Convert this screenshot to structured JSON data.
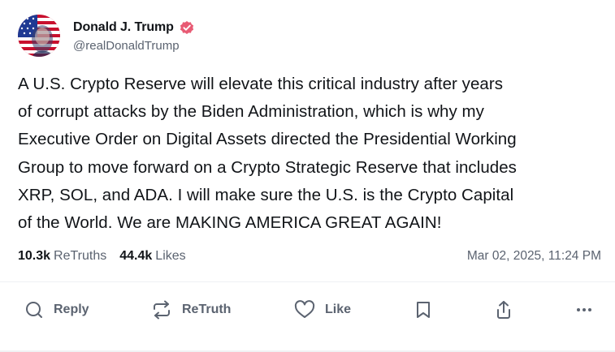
{
  "author": {
    "display_name": "Donald J. Trump",
    "handle": "@realDonaldTrump",
    "verified": true,
    "avatar_icon": "avatar-flag-portrait",
    "verified_color": "#e85b74"
  },
  "post": {
    "text": "A U.S. Crypto Reserve will elevate this critical industry after years\nof corrupt attacks by the Biden Administration, which is why my\nExecutive Order on Digital Assets directed the Presidential Working\nGroup to move forward on a Crypto Strategic Reserve that includes\nXRP, SOL, and ADA. I will make sure the U.S. is the Crypto Capital\nof the World. We are MAKING AMERICA GREAT AGAIN!",
    "retruths_count": "10.3k",
    "retruths_label": "ReTruths",
    "likes_count": "44.4k",
    "likes_label": "Likes",
    "timestamp": "Mar 02, 2025, 11:24 PM"
  },
  "actions": {
    "reply_label": "Reply",
    "retruth_label": "ReTruth",
    "like_label": "Like",
    "icons": [
      "reply-icon",
      "retruth-icon",
      "like-icon",
      "bookmark-icon",
      "share-icon",
      "more-icon"
    ]
  },
  "colors": {
    "text_primary": "#111418",
    "text_secondary": "#5b6370",
    "divider": "#eef0f3"
  }
}
